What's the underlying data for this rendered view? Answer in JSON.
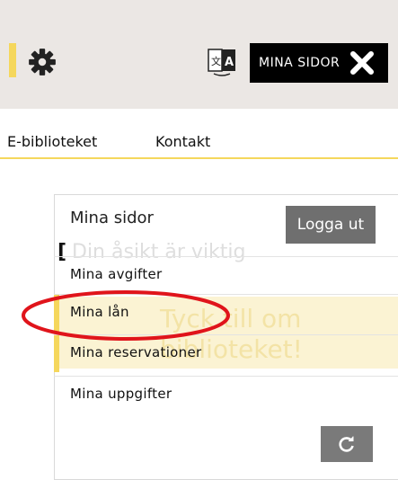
{
  "header": {
    "mina_sidor_label": "MINA SIDOR",
    "accent_color": "#f5d75c",
    "bar_color": "#ebe7e4"
  },
  "nav": {
    "items": [
      "E-biblioteket",
      "Kontakt"
    ]
  },
  "background": {
    "bracket": "[",
    "asikt": "Din åsikt är viktig",
    "tyck": "Tyck till om",
    "bibl": "biblioteket!"
  },
  "panel": {
    "title": "Mina sidor",
    "logout_label": "Logga ut",
    "items": [
      {
        "label": "Mina avgifter"
      },
      {
        "label": "Mina lån"
      },
      {
        "label": "Mina reservationer"
      },
      {
        "label": "Mina uppgifter"
      }
    ],
    "active_index": 2
  },
  "icons": {
    "settings": "gear-icon",
    "translate": "translate-icon",
    "close": "close-icon",
    "refresh": "refresh-icon"
  },
  "annotation_color": "#e0141b"
}
